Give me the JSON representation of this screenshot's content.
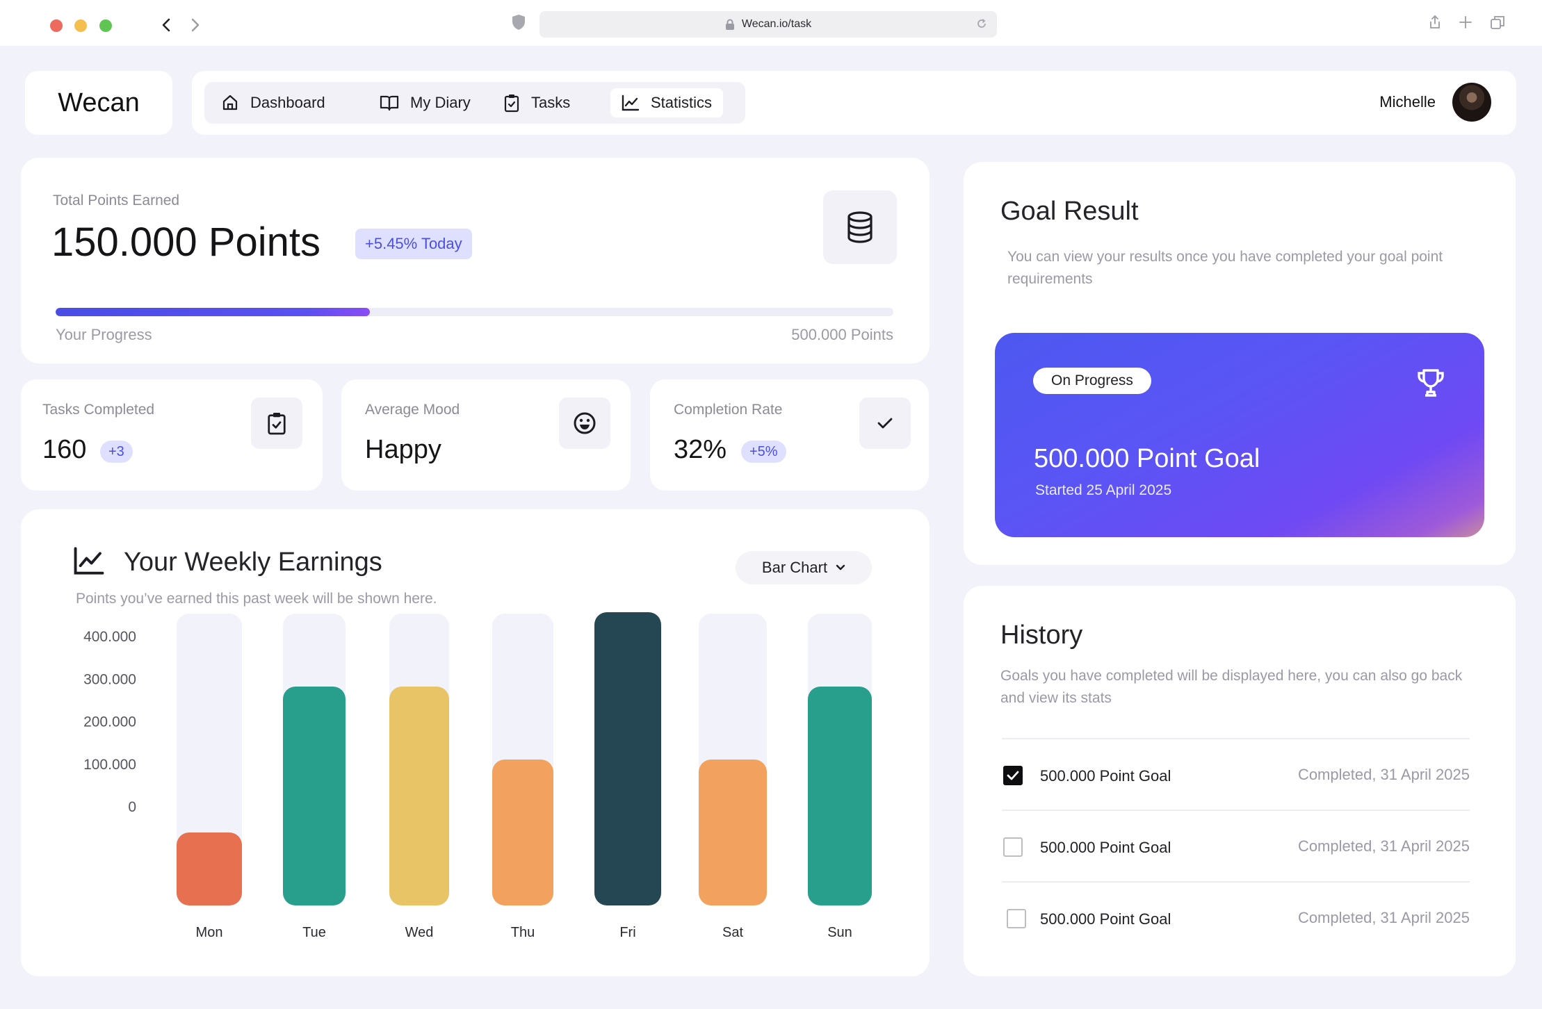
{
  "browser": {
    "url": "Wecan.io/task"
  },
  "header": {
    "logo": "Wecan",
    "tabs": [
      {
        "label": "Dashboard",
        "icon": "home-icon"
      },
      {
        "label": "My Diary",
        "icon": "book-icon"
      },
      {
        "label": "Tasks",
        "icon": "clipboard-check-icon"
      },
      {
        "label": "Statistics",
        "icon": "chart-line-icon",
        "active": true
      }
    ],
    "user_name": "Michelle"
  },
  "points": {
    "label": "Total Points Earned",
    "value": "150.000 Points",
    "today_badge": "+5.45% Today",
    "progress_label": "Your Progress",
    "goal_label": "500.000 Points",
    "progress_fraction": 0.375
  },
  "stats": [
    {
      "label": "Tasks Completed",
      "value": "160",
      "badge": "+3",
      "icon": "clipboard-check-icon"
    },
    {
      "label": "Average Mood",
      "value": "Happy",
      "badge": "",
      "icon": "smiley-icon"
    },
    {
      "label": "Completion Rate",
      "value": "32%",
      "badge": "+5%",
      "icon": "check-icon"
    }
  ],
  "weekly": {
    "title": "Your Weekly Earnings",
    "subtitle": "Points you’ve earned this past week will be shown here.",
    "chart_type_select": "Bar Chart"
  },
  "chart_data": {
    "type": "bar",
    "categories": [
      "Mon",
      "Tue",
      "Wed",
      "Thu",
      "Fri",
      "Sat",
      "Sun"
    ],
    "values": [
      100000,
      300000,
      300000,
      200000,
      420000,
      200000,
      300000
    ],
    "ylim": [
      0,
      400000
    ],
    "yticks": [
      "400.000",
      "300.000",
      "200.000",
      "100.000",
      "0"
    ],
    "colors": [
      "#e6704f",
      "#289e8d",
      "#e8c466",
      "#f2a25e",
      "#254653",
      "#f2a25e",
      "#289e8d"
    ],
    "track_color": "#f2f2fb"
  },
  "goal": {
    "title": "Goal Result",
    "description": "You can view your results once you have completed your goal point requirements",
    "status": "On Progress",
    "goal_name": "500.000 Point Goal",
    "started": "Started 25 April 2025"
  },
  "history": {
    "title": "History",
    "description": "Goals you have completed will be displayed here, you can also go back and view its stats",
    "items": [
      {
        "name": "500.000 Point Goal",
        "date": "Completed, 31 April 2025",
        "checked": true
      },
      {
        "name": "500.000 Point Goal",
        "date": "Completed, 31 April 2025",
        "checked": false
      },
      {
        "name": "500.000 Point Goal",
        "date": "Completed, 31 April 2025",
        "checked": false
      }
    ]
  }
}
